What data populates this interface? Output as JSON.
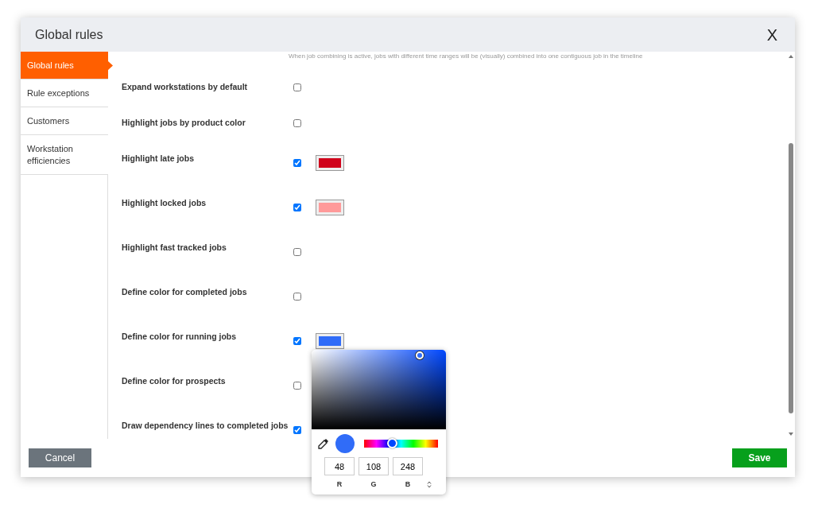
{
  "dialog": {
    "title": "Global rules",
    "close": "X"
  },
  "sidebar": {
    "items": [
      {
        "label": "Global rules",
        "selected": true
      },
      {
        "label": "Rule exceptions",
        "selected": false
      },
      {
        "label": "Customers",
        "selected": false
      },
      {
        "label": "Workstation efficiencies",
        "selected": false
      }
    ]
  },
  "note": "When job combining is active, jobs with different time ranges will be (visually) combined into one contiguous job in the timeline",
  "rules": [
    {
      "label": "Expand workstations by default",
      "checked": false
    },
    {
      "label": "Highlight jobs by product color",
      "checked": false
    },
    {
      "label": "Highlight late jobs",
      "checked": true,
      "color": "#d0021b"
    },
    {
      "label": "Highlight locked jobs",
      "checked": true,
      "color": "#ff9a9a"
    },
    {
      "label": "Highlight fast tracked jobs",
      "checked": false
    },
    {
      "label": "Define color for completed jobs",
      "checked": false
    },
    {
      "label": "Define color for running jobs",
      "checked": true,
      "color": "#306cf8"
    },
    {
      "label": "Define color for prospects",
      "checked": false
    },
    {
      "label": "Draw dependency lines to completed jobs",
      "checked": true
    }
  ],
  "color_picker": {
    "preview": {
      "color": "#306cf8"
    },
    "hue_slider": {
      "level": 0.38
    },
    "fields": [
      {
        "label": "R",
        "value": "48"
      },
      {
        "label": "G",
        "value": "108"
      },
      {
        "label": "B",
        "value": "248"
      }
    ]
  },
  "buttons": {
    "cancel": "Cancel",
    "save": "Save"
  }
}
